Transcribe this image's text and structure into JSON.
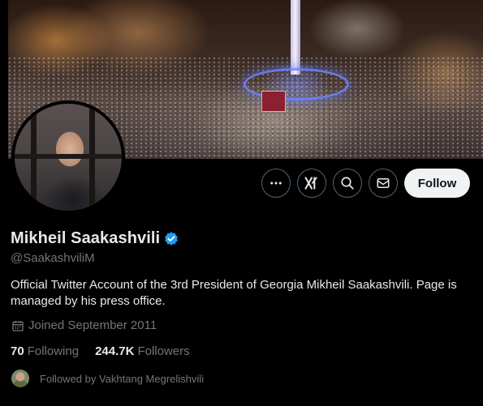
{
  "profile": {
    "display_name": "Mikheil Saakashvili",
    "handle": "@SaakashviliM",
    "bio": "Official Twitter Account of the 3rd President of Georgia Mikheil Saakashvili. Page is managed by his press office.",
    "joined": "Joined September 2011",
    "following_count": "70",
    "following_label": "Following",
    "followers_count": "244.7K",
    "followers_label": "Followers",
    "followed_by": "Followed by Vakhtang Megrelishvili"
  },
  "actions": {
    "more_icon": "more-icon",
    "grok_icon": "grok-icon",
    "search_icon": "search-icon",
    "message_icon": "message-icon",
    "follow_label": "Follow"
  },
  "colors": {
    "background": "#000000",
    "primary_text": "#e7e9ea",
    "secondary_text": "#71767b",
    "verified_blue": "#1d9bf0",
    "follow_button_bg": "#eff3f4"
  }
}
